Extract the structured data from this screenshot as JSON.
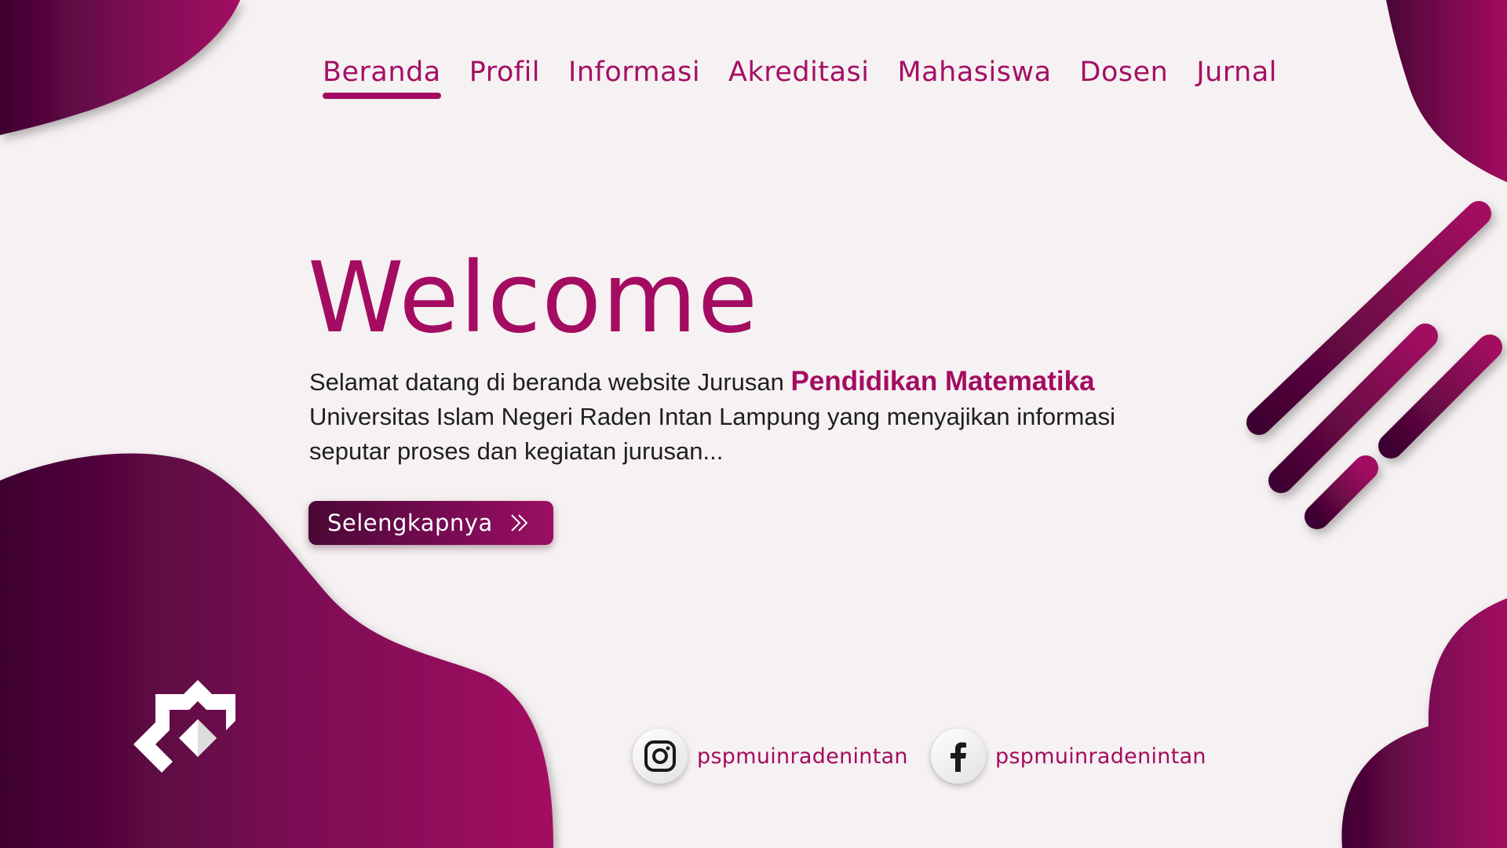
{
  "colors": {
    "accent": "#a30c61",
    "dark_accent": "#3e0430",
    "background": "#f6f1f2"
  },
  "nav": {
    "items": [
      {
        "label": "Beranda",
        "active": true
      },
      {
        "label": "Profil"
      },
      {
        "label": "Informasi"
      },
      {
        "label": "Akreditasi"
      },
      {
        "label": "Mahasiswa"
      },
      {
        "label": "Dosen"
      },
      {
        "label": "Jurnal"
      }
    ]
  },
  "hero": {
    "title": "Welcome",
    "text_prefix": "Selamat datang di beranda website Jurusan ",
    "text_highlight": "Pendidikan Matematika",
    "text_suffix": "Universitas Islam Negeri Raden Intan Lampung yang menyajikan informasi seputar proses dan kegiatan jurusan...",
    "cta_label": "Selengkapnya",
    "cta_icon": "double-chevron-right-icon"
  },
  "social": [
    {
      "icon": "instagram-icon",
      "handle": "pspmuinradenintan"
    },
    {
      "icon": "facebook-icon",
      "handle": "pspmuinradenintan"
    }
  ],
  "logo": {
    "icon": "university-logo-icon"
  }
}
